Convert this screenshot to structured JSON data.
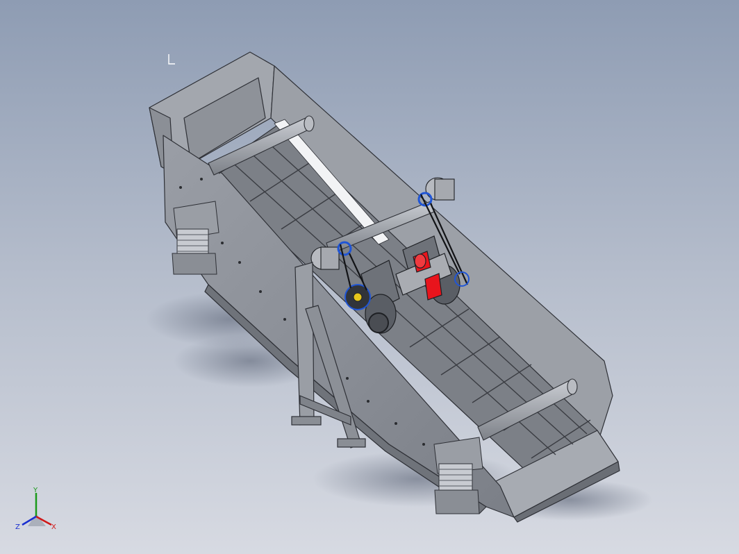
{
  "view": {
    "background_top": "#8e9cb3",
    "background_bottom": "#d7dae2",
    "model_color": "#8a8e95",
    "highlight_color_red": "#e8141c",
    "highlight_color_blue": "#1f55d6"
  },
  "triad": {
    "x_label": "X",
    "y_label": "Y",
    "z_label": "Z",
    "x_color": "#d01818",
    "y_color": "#1a9a1a",
    "z_color": "#1a2fd0"
  }
}
